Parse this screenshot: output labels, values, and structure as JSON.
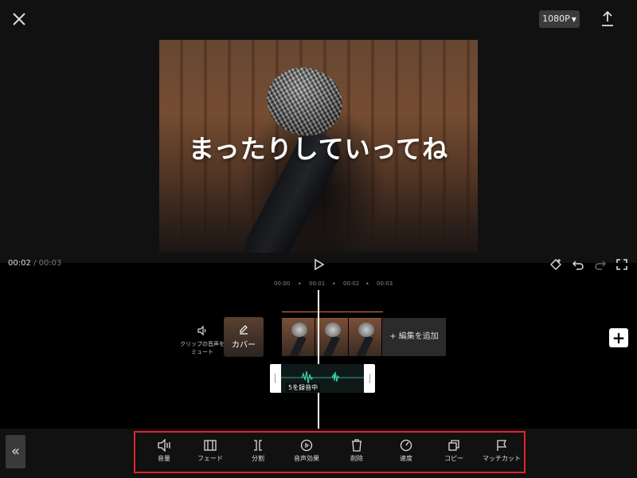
{
  "header": {
    "resolution": "1080P"
  },
  "preview": {
    "caption": "まったりしていってね"
  },
  "playback": {
    "current": "00:02",
    "separator": "/",
    "total": "00:03"
  },
  "timeline": {
    "ruler": [
      "00:00",
      "00:01",
      "00:02",
      "00:03"
    ],
    "mute_label": "クリップの音声をミュート",
    "cover_label": "カバー",
    "add_edit_label": "+ 編集を追加",
    "recording_label": "5を録音中"
  },
  "toolbar": {
    "items": [
      {
        "label": "音量",
        "icon": "volume-icon"
      },
      {
        "label": "フェード",
        "icon": "fade-icon"
      },
      {
        "label": "分割",
        "icon": "split-icon"
      },
      {
        "label": "音声効果",
        "icon": "voice-effect-icon"
      },
      {
        "label": "削除",
        "icon": "delete-icon"
      },
      {
        "label": "速度",
        "icon": "speed-icon"
      },
      {
        "label": "コピー",
        "icon": "copy-icon"
      },
      {
        "label": "マッチカット",
        "icon": "match-cut-icon"
      }
    ]
  },
  "colors": {
    "highlight": "#e0242d",
    "waveform": "#3ecfae",
    "accent_line": "#e07a3a"
  }
}
